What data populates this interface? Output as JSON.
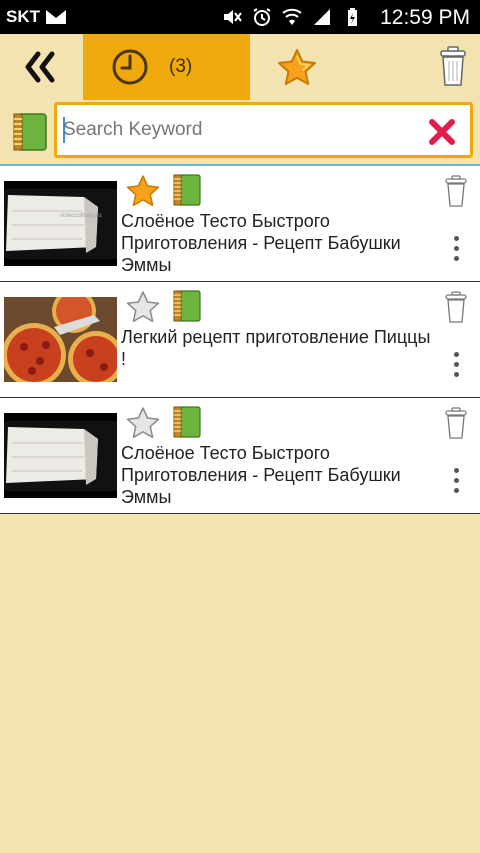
{
  "status_bar": {
    "carrier": "SKT",
    "time": "12:59 PM",
    "icons": [
      "mail-icon",
      "mute-icon",
      "alarm-icon",
      "wifi-icon",
      "signal-icon",
      "battery-icon"
    ]
  },
  "toolbar": {
    "back_icon": "double-chevron-left-icon",
    "history_icon": "clock-icon",
    "history_count": "(3)",
    "favorites_icon": "star-icon",
    "delete_icon": "trash-icon",
    "active_tab_color": "#f0a90c"
  },
  "search": {
    "placeholder": "Search Keyword",
    "value": "",
    "clear_icon": "close-x-icon",
    "notebook_icon": "notebook-icon"
  },
  "items": [
    {
      "title": "Слоёное Тесто Быстрого Приготовления -  Рецепт Бабушки Эммы",
      "favorite": true,
      "thumb": "dough",
      "thumb_watermark": "videoculinary.ru"
    },
    {
      "title": "Легкий рецепт приготовление Пиццы !",
      "favorite": false,
      "thumb": "pizza"
    },
    {
      "title": "Слоёное Тесто Быстрого Приготовления -  Рецепт Бабушки Эммы",
      "favorite": false,
      "thumb": "dough"
    }
  ],
  "colors": {
    "background": "#f3e3b0",
    "accent": "#f0a90c",
    "clear": "#e0204a"
  }
}
